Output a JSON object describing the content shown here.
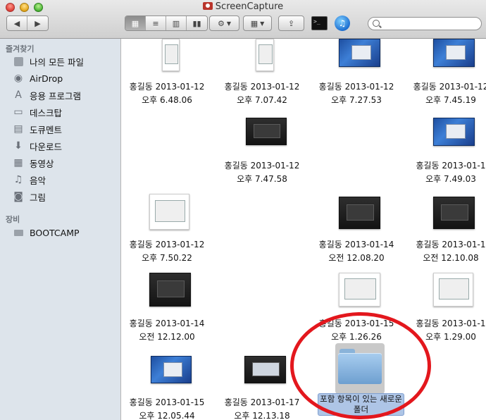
{
  "window": {
    "title": "ScreenCapture"
  },
  "search": {
    "placeholder": "",
    "value": ""
  },
  "sidebar": {
    "favorites_header": "즐겨찾기",
    "favorites": [
      {
        "label": "나의 모든 파일",
        "icon": "all-files-icon"
      },
      {
        "label": "AirDrop",
        "icon": "airdrop-icon"
      },
      {
        "label": "응용 프로그램",
        "icon": "applications-icon"
      },
      {
        "label": "데스크탑",
        "icon": "desktop-icon"
      },
      {
        "label": "도큐멘트",
        "icon": "documents-icon"
      },
      {
        "label": "다운로드",
        "icon": "downloads-icon"
      },
      {
        "label": "동영상",
        "icon": "movies-icon"
      },
      {
        "label": "음악",
        "icon": "music-icon"
      },
      {
        "label": "그림",
        "icon": "pictures-icon"
      }
    ],
    "devices_header": "장비",
    "devices": [
      {
        "label": "BOOTCAMP",
        "icon": "drive-icon"
      }
    ]
  },
  "files": [
    {
      "line1": "홍길동 2013-01-12",
      "line2": "오후 6.48.06",
      "thumb": "light"
    },
    {
      "line1": "홍길동 2013-01-12",
      "line2": "오후 7.07.42",
      "thumb": "light"
    },
    {
      "line1": "홍길동 2013-01-12",
      "line2": "오후 7.27.53",
      "thumb": "win"
    },
    {
      "line1": "홍길동 2013-01-12",
      "line2": "오후 7.45.19",
      "thumb": "win"
    },
    {
      "line1": "홍길동 2013-01-12",
      "line2": "오후 7.47.58",
      "thumb": "dark"
    },
    {
      "line1": "홍길동 2013-01-1",
      "line2": "오후 7.49.03",
      "thumb": "win"
    },
    {
      "line1": "홍길동 2013-01-12",
      "line2": "오후 7.50.22",
      "thumb": "light"
    },
    {
      "line1": "홍길동 2013-01-14",
      "line2": "오전 12.08.20",
      "thumb": "dark"
    },
    {
      "line1": "홍길동 2013-01-1",
      "line2": "오전 12.10.08",
      "thumb": "dark"
    },
    {
      "line1": "홍길동 2013-01-14",
      "line2": "오전 12.12.00",
      "thumb": "dark"
    },
    {
      "line1": "홍길동 2013-01-15",
      "line2": "오후 1.26.26",
      "thumb": "light"
    },
    {
      "line1": "홍길동 2013-01-1",
      "line2": "오후 1.29.00",
      "thumb": "light"
    },
    {
      "line1": "홍길동 2013-01-15",
      "line2": "오후 12.05.44",
      "thumb": "win"
    },
    {
      "line1": "홍길동 2013-01-17",
      "line2": "오후 12.13.18",
      "thumb": "dark"
    }
  ],
  "new_folder": {
    "label": "포함 항목이 있는 새로운 폴더"
  }
}
